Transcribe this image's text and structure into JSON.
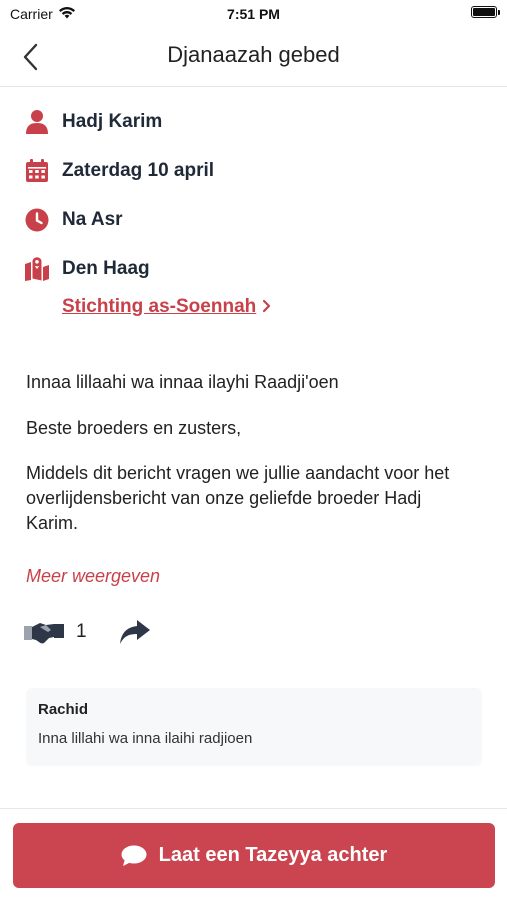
{
  "status_bar": {
    "carrier": "Carrier",
    "time": "7:51 PM"
  },
  "nav": {
    "title": "Djanaazah gebed",
    "back_icon": "chevron-left-icon"
  },
  "details": {
    "name": "Hadj Karim",
    "date": "Zaterdag 10 april",
    "time": "Na Asr",
    "location": "Den Haag",
    "organization": "Stichting as-Soennah",
    "icons": [
      "user-icon",
      "calendar-icon",
      "clock-icon",
      "map-icon"
    ]
  },
  "message": {
    "line1": "Innaa lillaahi wa innaa ilayhi Raadji'oen",
    "line2": "Beste broeders en zusters,",
    "line3": "Middels dit bericht vragen we jullie aandacht voor het overlijdensbericht van onze geliefde broeder Hadj Karim.",
    "more_label": "Meer weergeven"
  },
  "actions": {
    "condolence_count": "1"
  },
  "comments": [
    {
      "author": "Rachid",
      "text": "Inna lillahi wa inna ilaihi radjioen"
    }
  ],
  "cta": {
    "label": "Laat een Tazeyya achter"
  },
  "colors": {
    "accent": "#cb4550",
    "text": "#1f2937"
  }
}
